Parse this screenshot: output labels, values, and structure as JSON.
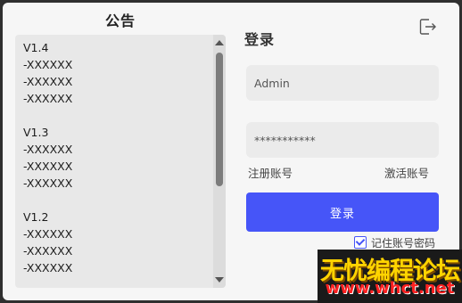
{
  "announcement": {
    "title": "公告",
    "lines": [
      "V1.4",
      "-XXXXXX",
      "-XXXXXX",
      "-XXXXXX",
      "",
      "V1.3",
      "-XXXXXX",
      "-XXXXXX",
      "-XXXXXX",
      "",
      "V1.2",
      "-XXXXXX",
      "-XXXXXX",
      "-XXXXXX"
    ]
  },
  "login": {
    "title": "登录",
    "username_value": "Admin",
    "password_value": "***********",
    "register_link": "注册账号",
    "activate_link": "激活账号",
    "login_button": "登录",
    "remember_label": "记住账号密码",
    "remember_checked": true
  },
  "icons": {
    "exit": "exit-icon"
  },
  "colors": {
    "accent": "#4655f8",
    "background": "#f6f6f6",
    "field": "#ebebeb"
  },
  "watermark": {
    "main": "无忧编程论坛",
    "sub": "www.whct.net"
  }
}
